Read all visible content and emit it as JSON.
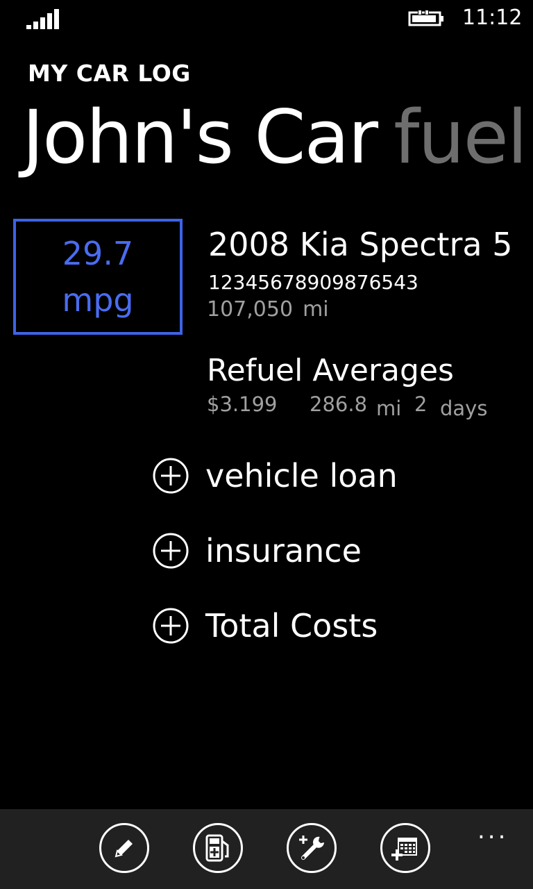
{
  "status_bar": {
    "time": "11:12",
    "signal_icon": "signal-strength-icon",
    "battery_icon": "battery-charging-icon"
  },
  "header": {
    "app_title": "MY CAR LOG",
    "pivot_current": "John's Car",
    "pivot_next": "fuel"
  },
  "efficiency": {
    "value": "29.7",
    "unit": "mpg",
    "accent_color": "#3d63e6"
  },
  "vehicle": {
    "name": "2008 Kia Spectra 5",
    "vin": "12345678909876543",
    "odometer": "107,050",
    "odometer_unit": "mi"
  },
  "refuel_averages": {
    "title": "Refuel Averages",
    "price": "$3.199",
    "distance": "286.8",
    "distance_unit": "mi",
    "interval": "2",
    "interval_unit": "days"
  },
  "sections": [
    {
      "label": "vehicle loan",
      "icon": "add-circle-icon"
    },
    {
      "label": "insurance",
      "icon": "add-circle-icon"
    },
    {
      "label": "Total Costs",
      "icon": "add-circle-icon"
    }
  ],
  "app_bar": {
    "buttons": [
      {
        "icon": "edit-pencil-icon"
      },
      {
        "icon": "add-fuel-icon"
      },
      {
        "icon": "add-service-wrench-icon"
      },
      {
        "icon": "add-calendar-icon"
      }
    ],
    "more": "..."
  }
}
